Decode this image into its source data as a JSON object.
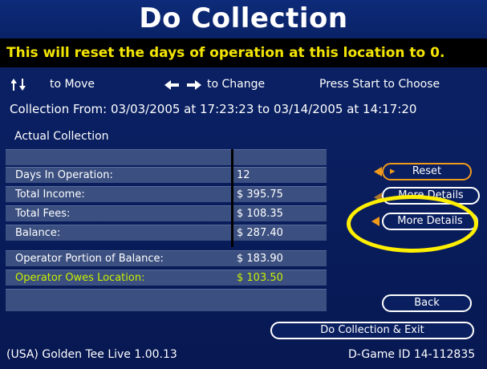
{
  "header": {
    "title": "Do Collection"
  },
  "warning": "This will reset the days of operation at this location to 0.",
  "help": {
    "move": "to Move",
    "change": "to Change",
    "start": "Press Start to Choose"
  },
  "collection_from": "Collection From: 03/03/2005 at 17:23:23 to 03/14/2005 at 14:17:20",
  "actual_collection": "Actual Collection",
  "rows": [
    {
      "label": "",
      "value": ""
    },
    {
      "label": "Days In Operation:",
      "value": "12"
    },
    {
      "label": "Total Income:",
      "value": "$ 395.75"
    },
    {
      "label": "Total Fees:",
      "value": "$ 108.35"
    },
    {
      "label": "Balance:",
      "value": "$ 287.40"
    },
    {
      "label": "Operator Portion of Balance:",
      "value": "$ 183.90"
    },
    {
      "label": "Operator Owes Location:",
      "value": "$ 103.50"
    },
    {
      "label": "",
      "value": ""
    }
  ],
  "buttons": {
    "reset": "Reset",
    "more_details_1": "More Details",
    "more_details_2": "More Details",
    "back": "Back",
    "do_collection_exit": "Do Collection & Exit"
  },
  "footer": {
    "version": "(USA) Golden Tee Live 1.00.13",
    "game_id": "D-Game ID 14-112835"
  },
  "colors": {
    "accent": "#f09a1a",
    "highlight": "#ffef00",
    "warning_text": "#f3e400",
    "owes_text": "#c8f000"
  }
}
